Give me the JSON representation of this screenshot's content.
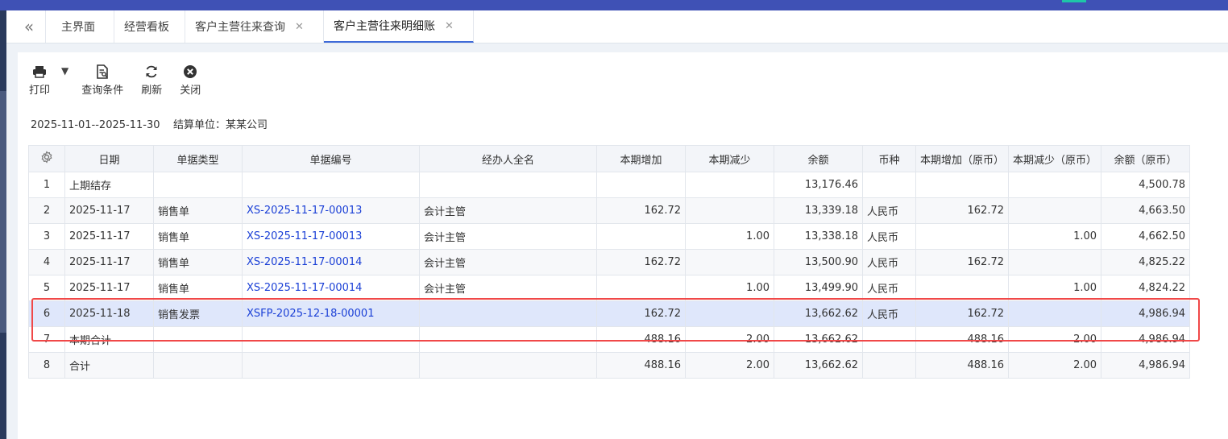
{
  "tabs": [
    {
      "label": "主界面",
      "closable": false
    },
    {
      "label": "经营看板",
      "closable": false
    },
    {
      "label": "客户主营往来查询",
      "closable": true
    },
    {
      "label": "客户主营往来明细账",
      "closable": true,
      "active": true
    }
  ],
  "toolbar": {
    "print": "打印",
    "query": "查询条件",
    "refresh": "刷新",
    "close": "关闭"
  },
  "info": {
    "date_range": "2025-11-01--2025-11-30",
    "unit_label": "结算单位：某某公司"
  },
  "table": {
    "headers": [
      "日期",
      "单据类型",
      "单据编号",
      "经办人全名",
      "本期增加",
      "本期减少",
      "余额",
      "币种",
      "本期增加（原币）",
      "本期减少（原币）",
      "余额（原币）"
    ],
    "rows": [
      {
        "no": "1",
        "date": "上期结存",
        "type": "",
        "docno": "",
        "handler": "",
        "inc": "",
        "dec": "",
        "bal": "13,176.46",
        "cur": "",
        "inc_o": "",
        "dec_o": "",
        "bal_o": "4,500.78"
      },
      {
        "no": "2",
        "date": "2025-11-17",
        "type": "销售单",
        "docno": "XS-2025-11-17-00013",
        "handler": "会计主管",
        "inc": "162.72",
        "dec": "",
        "bal": "13,339.18",
        "cur": "人民币",
        "inc_o": "162.72",
        "dec_o": "",
        "bal_o": "4,663.50"
      },
      {
        "no": "3",
        "date": "2025-11-17",
        "type": "销售单",
        "docno": "XS-2025-11-17-00013",
        "handler": "会计主管",
        "inc": "",
        "dec": "1.00",
        "bal": "13,338.18",
        "cur": "人民币",
        "inc_o": "",
        "dec_o": "1.00",
        "bal_o": "4,662.50"
      },
      {
        "no": "4",
        "date": "2025-11-17",
        "type": "销售单",
        "docno": "XS-2025-11-17-00014",
        "handler": "会计主管",
        "inc": "162.72",
        "dec": "",
        "bal": "13,500.90",
        "cur": "人民币",
        "inc_o": "162.72",
        "dec_o": "",
        "bal_o": "4,825.22"
      },
      {
        "no": "5",
        "date": "2025-11-17",
        "type": "销售单",
        "docno": "XS-2025-11-17-00014",
        "handler": "会计主管",
        "inc": "",
        "dec": "1.00",
        "bal": "13,499.90",
        "cur": "人民币",
        "inc_o": "",
        "dec_o": "1.00",
        "bal_o": "4,824.22"
      },
      {
        "no": "6",
        "date": "2025-11-18",
        "type": "销售发票",
        "docno": "XSFP-2025-12-18-00001",
        "handler": "",
        "inc": "162.72",
        "dec": "",
        "bal": "13,662.62",
        "cur": "人民币",
        "inc_o": "162.72",
        "dec_o": "",
        "bal_o": "4,986.94",
        "selected": true
      },
      {
        "no": "7",
        "date": "本期合计",
        "type": "",
        "docno": "",
        "handler": "",
        "inc": "488.16",
        "dec": "2.00",
        "bal": "13,662.62",
        "cur": "",
        "inc_o": "488.16",
        "dec_o": "2.00",
        "bal_o": "4,986.94"
      },
      {
        "no": "8",
        "date": "合计",
        "type": "",
        "docno": "",
        "handler": "",
        "inc": "488.16",
        "dec": "2.00",
        "bal": "13,662.62",
        "cur": "",
        "inc_o": "488.16",
        "dec_o": "2.00",
        "bal_o": "4,986.94"
      }
    ]
  },
  "colors": {
    "accent": "#3f51b5",
    "link": "#1a3fd6",
    "selected_row": "#dfe7fb",
    "highlight_border": "#f04848"
  }
}
